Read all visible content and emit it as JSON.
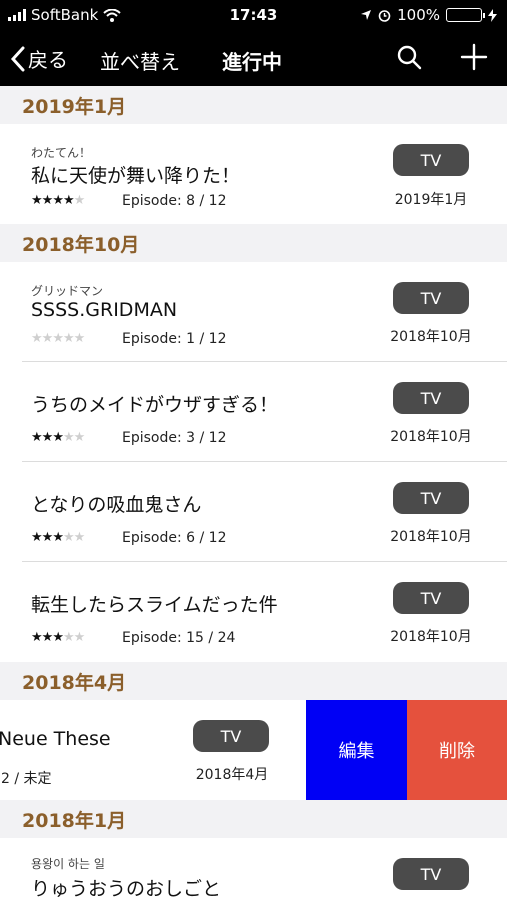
{
  "status": {
    "carrier": "SoftBank",
    "time": "17:43",
    "battery": "100%",
    "battery_level": 1.0
  },
  "nav": {
    "back": "戻る",
    "sort": "並べ替え",
    "title": "進行中"
  },
  "sections": [
    {
      "title": "2019年1月"
    },
    {
      "title": "2018年10月"
    },
    {
      "title": "2018年4月"
    },
    {
      "title": "2018年1月"
    }
  ],
  "items": [
    {
      "sub": "わたてん！",
      "name": "私に天使が舞い降りた！",
      "rating": 4,
      "episode": "Episode: 8 / 12",
      "type": "TV",
      "date": "2019年1月"
    },
    {
      "sub": "グリッドマン",
      "name": "SSSS.GRIDMAN",
      "rating": 0,
      "episode": "Episode: 1 / 12",
      "type": "TV",
      "date": "2018年10月"
    },
    {
      "sub": "",
      "name": "うちのメイドがウザすぎる！",
      "rating": 3,
      "episode": "Episode: 3 / 12",
      "type": "TV",
      "date": "2018年10月"
    },
    {
      "sub": "",
      "name": "となりの吸血鬼さん",
      "rating": 3,
      "episode": "Episode: 6 / 12",
      "type": "TV",
      "date": "2018年10月"
    },
    {
      "sub": "",
      "name": "転生したらスライムだった件",
      "rating": 3,
      "episode": "Episode: 15 / 24",
      "type": "TV",
      "date": "2018年10月"
    }
  ],
  "swiped": {
    "name": "Neue These",
    "episode": "2 / 未定",
    "type": "TV",
    "date": "2018年4月",
    "edit": "編集",
    "delete": "削除"
  },
  "last": {
    "sub": "용왕이 하는 일",
    "name": "りゅうおうのおしごと",
    "type": "TV"
  }
}
